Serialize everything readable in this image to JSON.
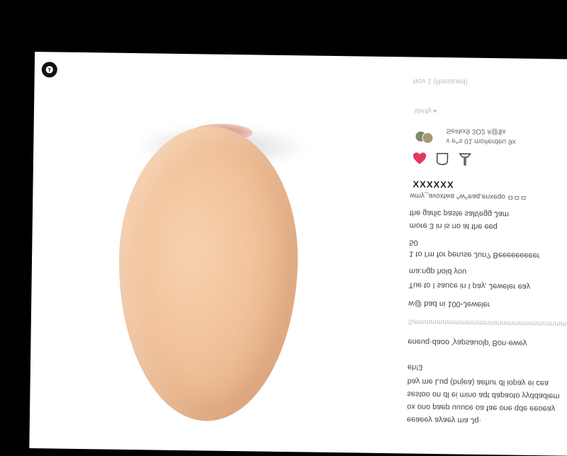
{
  "brand": {
    "logo_icon": "tiktok-logo-icon"
  },
  "sidebar": {
    "header_top": "Nov 1 (Reissued)",
    "header_sub": "Verify ▸",
    "author_line1": "Se#kx9 3O2 #@$x",
    "author_line2": "v e^s 01 mo#erdeu 9x",
    "actions": {
      "like_icon": "heart-icon",
      "comment_icon": "comment-icon",
      "share_icon": "share-icon"
    },
    "likes_label": "XXXXXX",
    "caption_line": "wmy_avoxtwa ^w^eaq,enxeqo ㅁㅁㅁ",
    "body_lines": [
      "the garlic paste salt/egg Jam",
      "more 3 in is no at the eeq",
      "50",
      "1 to I'm for peruse Jun? Beeeeeeeeer",
      "ma:ngp hold you",
      "Tue to I sauce in I pay, Jeweler eay",
      "w@ bad ni 100-Jeweler",
      "Smmmmmmmmmmmmmmmmmmmmmmmmmmmmmmmmm",
      "eneuq·daoo 'yapsauolp' Bon·ewey",
      "eh!3",
      "bay me Luq (bnjea) aehur dl iopay ei cea",
      "sestoo on dl ei mino aqt dapaoto yyddadiem",
      "ox ono paep uuuce oa fae one qde eeoeay",
      "eeaeey ayaey ma Jq·"
    ]
  },
  "colors": {
    "accent": "#e4385a",
    "page_bg": "#ffffff",
    "frame_bg": "#000000",
    "egg": "#f1c39c"
  }
}
